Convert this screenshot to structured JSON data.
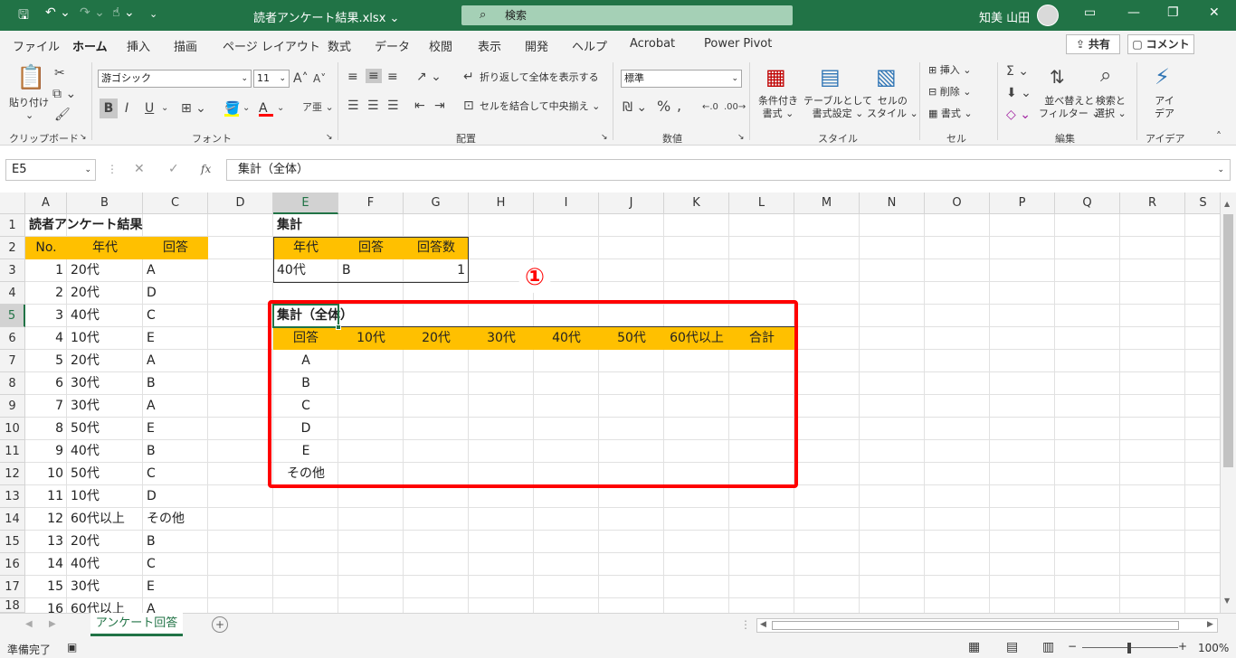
{
  "title": {
    "filename": "読者アンケート結果.xlsx",
    "search": "検索",
    "user": "知美 山田"
  },
  "menu": {
    "tabs": [
      "ファイル",
      "ホーム",
      "挿入",
      "描画",
      "ページ レイアウト",
      "数式",
      "データ",
      "校閲",
      "表示",
      "開発",
      "ヘルプ",
      "Acrobat",
      "Power Pivot"
    ],
    "share": "共有",
    "comment": "コメント"
  },
  "ribbon": {
    "paste": "貼り付け",
    "clipboard": "クリップボード",
    "font_name": "游ゴシック",
    "font_size": "11",
    "font_group": "フォント",
    "bold": "B",
    "italic": "I",
    "underline": "U",
    "wrap": "折り返して全体を表示する",
    "merge": "セルを結合して中央揃え",
    "align_group": "配置",
    "number_format": "標準",
    "number_group": "数値",
    "cond_format1": "条件付き",
    "cond_format2": "書式",
    "table_format1": "テーブルとして",
    "table_format2": "書式設定",
    "cell_style1": "セルの",
    "cell_style2": "スタイル",
    "style_group": "スタイル",
    "insert": "挿入",
    "delete": "削除",
    "format": "書式",
    "cell_group": "セル",
    "sort1": "並べ替えと",
    "sort2": "フィルター",
    "find1": "検索と",
    "find2": "選択",
    "edit_group": "編集",
    "ideas1": "アイ",
    "ideas2": "デア",
    "ideas_group": "アイデア"
  },
  "formula": {
    "name_box": "E5",
    "fx": "fx",
    "content": "集計（全体）"
  },
  "columns": [
    "A",
    "B",
    "C",
    "D",
    "E",
    "F",
    "G",
    "H",
    "I",
    "J",
    "K",
    "L",
    "M",
    "N",
    "O",
    "P",
    "Q",
    "R",
    "S"
  ],
  "rows": [
    "1",
    "2",
    "3",
    "4",
    "5",
    "6",
    "7",
    "8",
    "9",
    "10",
    "11",
    "12",
    "13",
    "14",
    "15",
    "16",
    "17",
    "18"
  ],
  "sheet": {
    "a1": "読者アンケート結果",
    "hdr_no": "No.",
    "hdr_age": "年代",
    "hdr_ans": "回答",
    "data": [
      [
        "1",
        "20代",
        "A"
      ],
      [
        "2",
        "20代",
        "D"
      ],
      [
        "3",
        "40代",
        "C"
      ],
      [
        "4",
        "10代",
        "E"
      ],
      [
        "5",
        "20代",
        "A"
      ],
      [
        "6",
        "30代",
        "B"
      ],
      [
        "7",
        "30代",
        "A"
      ],
      [
        "8",
        "50代",
        "E"
      ],
      [
        "9",
        "40代",
        "B"
      ],
      [
        "10",
        "50代",
        "C"
      ],
      [
        "11",
        "10代",
        "D"
      ],
      [
        "12",
        "60代以上",
        "その他"
      ],
      [
        "13",
        "20代",
        "B"
      ],
      [
        "14",
        "40代",
        "C"
      ],
      [
        "15",
        "30代",
        "E"
      ],
      [
        "16",
        "60代以上",
        "A"
      ]
    ],
    "e1": "集計",
    "e2": "年代",
    "f2": "回答",
    "g2": "回答数",
    "e3": "40代",
    "f3": "B",
    "g3": "1",
    "e5": "集計（全体）",
    "table_headers": [
      "回答",
      "10代",
      "20代",
      "30代",
      "40代",
      "50代",
      "60代以上",
      "合計"
    ],
    "table_rows": [
      "A",
      "B",
      "C",
      "D",
      "E",
      "その他"
    ]
  },
  "callout": "①",
  "sheet_tab": "アンケート回答",
  "status": {
    "ready": "準備完了",
    "zoom": "100%"
  }
}
